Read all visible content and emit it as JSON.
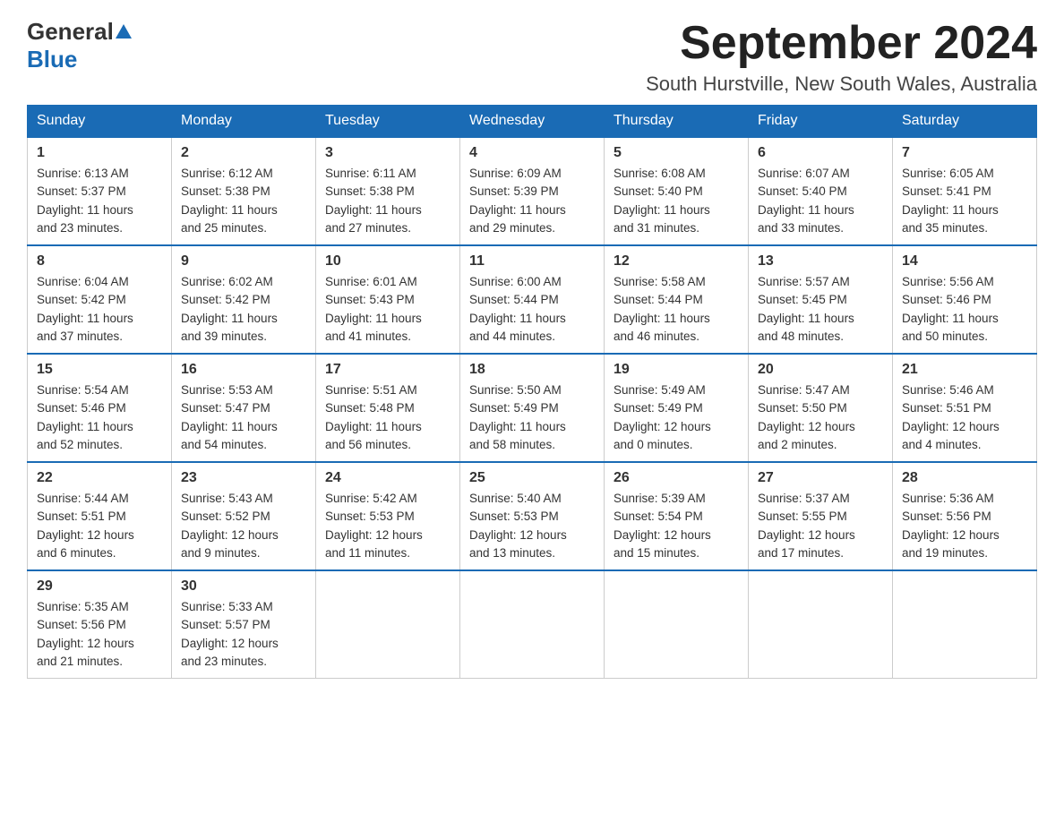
{
  "header": {
    "logo_general": "General",
    "logo_blue": "Blue",
    "month_title": "September 2024",
    "subtitle": "South Hurstville, New South Wales, Australia"
  },
  "days_of_week": [
    "Sunday",
    "Monday",
    "Tuesday",
    "Wednesday",
    "Thursday",
    "Friday",
    "Saturday"
  ],
  "weeks": [
    [
      {
        "day": "1",
        "sunrise": "6:13 AM",
        "sunset": "5:37 PM",
        "daylight": "11 hours and 23 minutes."
      },
      {
        "day": "2",
        "sunrise": "6:12 AM",
        "sunset": "5:38 PM",
        "daylight": "11 hours and 25 minutes."
      },
      {
        "day": "3",
        "sunrise": "6:11 AM",
        "sunset": "5:38 PM",
        "daylight": "11 hours and 27 minutes."
      },
      {
        "day": "4",
        "sunrise": "6:09 AM",
        "sunset": "5:39 PM",
        "daylight": "11 hours and 29 minutes."
      },
      {
        "day": "5",
        "sunrise": "6:08 AM",
        "sunset": "5:40 PM",
        "daylight": "11 hours and 31 minutes."
      },
      {
        "day": "6",
        "sunrise": "6:07 AM",
        "sunset": "5:40 PM",
        "daylight": "11 hours and 33 minutes."
      },
      {
        "day": "7",
        "sunrise": "6:05 AM",
        "sunset": "5:41 PM",
        "daylight": "11 hours and 35 minutes."
      }
    ],
    [
      {
        "day": "8",
        "sunrise": "6:04 AM",
        "sunset": "5:42 PM",
        "daylight": "11 hours and 37 minutes."
      },
      {
        "day": "9",
        "sunrise": "6:02 AM",
        "sunset": "5:42 PM",
        "daylight": "11 hours and 39 minutes."
      },
      {
        "day": "10",
        "sunrise": "6:01 AM",
        "sunset": "5:43 PM",
        "daylight": "11 hours and 41 minutes."
      },
      {
        "day": "11",
        "sunrise": "6:00 AM",
        "sunset": "5:44 PM",
        "daylight": "11 hours and 44 minutes."
      },
      {
        "day": "12",
        "sunrise": "5:58 AM",
        "sunset": "5:44 PM",
        "daylight": "11 hours and 46 minutes."
      },
      {
        "day": "13",
        "sunrise": "5:57 AM",
        "sunset": "5:45 PM",
        "daylight": "11 hours and 48 minutes."
      },
      {
        "day": "14",
        "sunrise": "5:56 AM",
        "sunset": "5:46 PM",
        "daylight": "11 hours and 50 minutes."
      }
    ],
    [
      {
        "day": "15",
        "sunrise": "5:54 AM",
        "sunset": "5:46 PM",
        "daylight": "11 hours and 52 minutes."
      },
      {
        "day": "16",
        "sunrise": "5:53 AM",
        "sunset": "5:47 PM",
        "daylight": "11 hours and 54 minutes."
      },
      {
        "day": "17",
        "sunrise": "5:51 AM",
        "sunset": "5:48 PM",
        "daylight": "11 hours and 56 minutes."
      },
      {
        "day": "18",
        "sunrise": "5:50 AM",
        "sunset": "5:49 PM",
        "daylight": "11 hours and 58 minutes."
      },
      {
        "day": "19",
        "sunrise": "5:49 AM",
        "sunset": "5:49 PM",
        "daylight": "12 hours and 0 minutes."
      },
      {
        "day": "20",
        "sunrise": "5:47 AM",
        "sunset": "5:50 PM",
        "daylight": "12 hours and 2 minutes."
      },
      {
        "day": "21",
        "sunrise": "5:46 AM",
        "sunset": "5:51 PM",
        "daylight": "12 hours and 4 minutes."
      }
    ],
    [
      {
        "day": "22",
        "sunrise": "5:44 AM",
        "sunset": "5:51 PM",
        "daylight": "12 hours and 6 minutes."
      },
      {
        "day": "23",
        "sunrise": "5:43 AM",
        "sunset": "5:52 PM",
        "daylight": "12 hours and 9 minutes."
      },
      {
        "day": "24",
        "sunrise": "5:42 AM",
        "sunset": "5:53 PM",
        "daylight": "12 hours and 11 minutes."
      },
      {
        "day": "25",
        "sunrise": "5:40 AM",
        "sunset": "5:53 PM",
        "daylight": "12 hours and 13 minutes."
      },
      {
        "day": "26",
        "sunrise": "5:39 AM",
        "sunset": "5:54 PM",
        "daylight": "12 hours and 15 minutes."
      },
      {
        "day": "27",
        "sunrise": "5:37 AM",
        "sunset": "5:55 PM",
        "daylight": "12 hours and 17 minutes."
      },
      {
        "day": "28",
        "sunrise": "5:36 AM",
        "sunset": "5:56 PM",
        "daylight": "12 hours and 19 minutes."
      }
    ],
    [
      {
        "day": "29",
        "sunrise": "5:35 AM",
        "sunset": "5:56 PM",
        "daylight": "12 hours and 21 minutes."
      },
      {
        "day": "30",
        "sunrise": "5:33 AM",
        "sunset": "5:57 PM",
        "daylight": "12 hours and 23 minutes."
      },
      null,
      null,
      null,
      null,
      null
    ]
  ],
  "labels": {
    "sunrise": "Sunrise:",
    "sunset": "Sunset:",
    "daylight": "Daylight:"
  }
}
